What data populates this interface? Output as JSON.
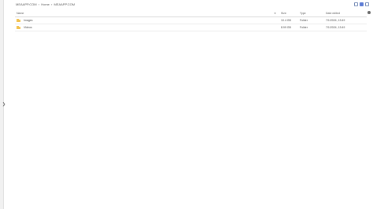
{
  "breadcrumb": {
    "items": [
      "MEAAPP.COM",
      "›",
      "Home",
      "›",
      "MEAAPP.COM"
    ]
  },
  "table": {
    "headers": {
      "name": "Name",
      "size": "Size",
      "type": "Type",
      "date": "Date edited"
    },
    "rows": [
      {
        "name": "Images",
        "size": "10.4 GB",
        "type": "Folder",
        "date": "7/1/2024, 13:49"
      },
      {
        "name": "Videos",
        "size": "8.99 GB",
        "type": "Folder",
        "date": "7/1/2024, 13:49"
      }
    ]
  },
  "colors": {
    "folder": "#f2c14e",
    "accent": "#5b7bd5"
  }
}
